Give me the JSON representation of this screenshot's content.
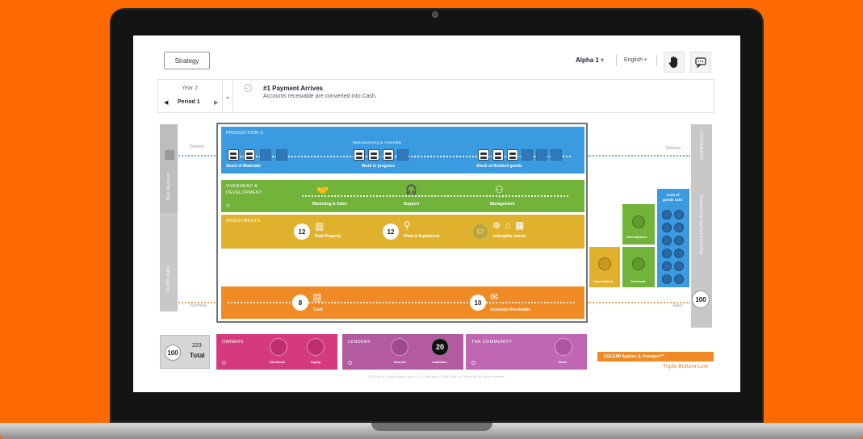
{
  "header": {
    "strategy_label": "Strategy",
    "team": "Alpha 1",
    "language": "English",
    "hand_icon": "hand-icon",
    "chat_icon": "chat-icon"
  },
  "period": {
    "year": "Year 2",
    "period": "Period 1",
    "event_title": "#1 Payment Arrives",
    "event_desc": "Accounts receivable are converted into Cash."
  },
  "side": {
    "buy_material": "Buy Material",
    "suppliers": "SUPPLIERS",
    "delivery_left": "Delivery",
    "purchase": "Purchase",
    "customers": "CUSTOMERS",
    "remaining_market": "Remaining market potential",
    "delivery_right": "Delivery",
    "sales": "Sales",
    "market_value": "100"
  },
  "production": {
    "title": "PRODUCTION",
    "stock_materials": "Stock of Materials",
    "manufacturing": "Manufacturing & Assembly",
    "wip": "Work in progress",
    "finished": "Stock of finished goods"
  },
  "overhead": {
    "title_1": "OVERHEAD &",
    "title_2": "DEVELOPMENT",
    "marketing": "Marketing & Sales",
    "support": "Support",
    "management": "Management"
  },
  "investments": {
    "title": "INVESTMENTS",
    "real_property_value": "12",
    "real_property": "Real Property",
    "plant_value": "12",
    "plant": "Plant & Equipment",
    "intangible_value": "57",
    "intangible": "Intangible assets"
  },
  "cash": {
    "cash_value": "8",
    "cash": "Cash",
    "ar_value": "10",
    "ar": "Accounts Receivable"
  },
  "costs": {
    "cogs_1": "Cost of",
    "cogs_2": "goods sold",
    "development": "Development",
    "depreciation": "Depreciation",
    "overhead": "Overhead"
  },
  "stakeholders": {
    "total_disc": "100",
    "total_number": "223",
    "total_label": "Total",
    "owners": "OWNERS",
    "dividends": "Dividends",
    "equity": "Equity",
    "lenders": "LENDERS",
    "interest": "Interest",
    "liabilities": "Liabilities",
    "liabilities_value": "20",
    "community": "THE COMMUNITY",
    "taxes": "Taxes"
  },
  "brand": {
    "name": "CELEMI Apples & Oranges™",
    "sub": "Triple Bottom Line"
  },
  "footer": "CELEMI AO Triple Bottom Line v. 1.0. Copyright © 1993-2018 by Celemi AB. All rights reserved.",
  "colors": {
    "background": "#ff6a00",
    "production": "#3a9be0",
    "overhead": "#72b33a",
    "investments": "#e0b12c",
    "cash": "#f08a24",
    "owners": "#d63a7e",
    "lenders": "#b35aa0",
    "community": "#c067b3"
  }
}
